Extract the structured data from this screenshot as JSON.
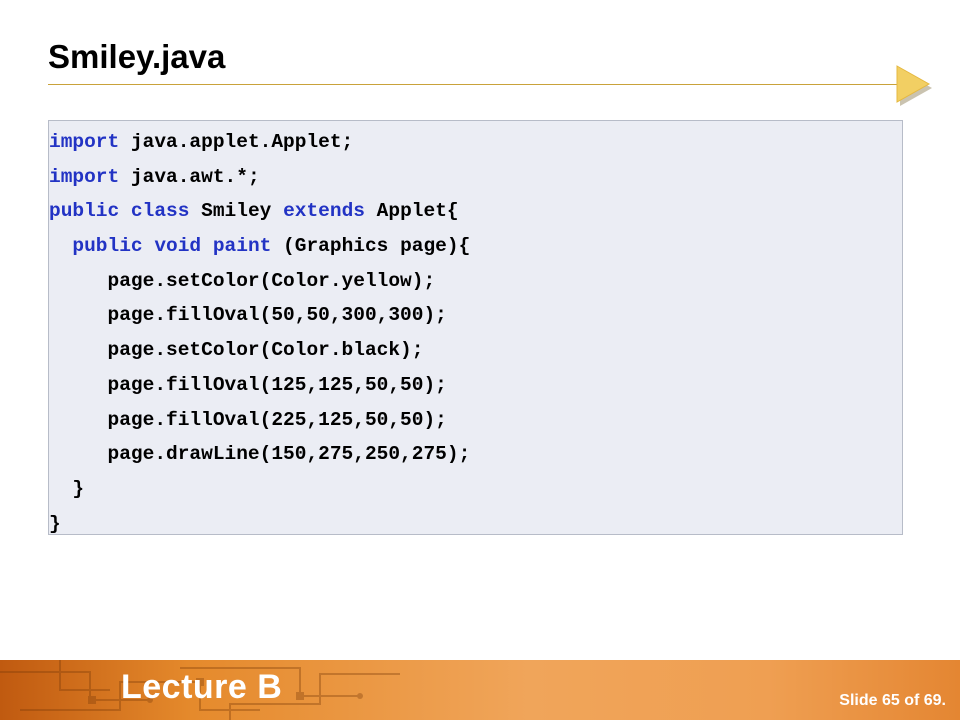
{
  "slide": {
    "title": "Smiley.java",
    "accent_color": "#c9a23a",
    "arrow_icon": "play-arrow-icon"
  },
  "code": {
    "keyword_color": "#2233c4",
    "lines": [
      [
        {
          "t": "import",
          "kw": true
        },
        {
          "t": " java.applet.Applet;",
          "kw": false
        }
      ],
      [
        {
          "t": "import",
          "kw": true
        },
        {
          "t": " java.awt.*;",
          "kw": false
        }
      ],
      [
        {
          "t": "public",
          "kw": true
        },
        {
          "t": " ",
          "kw": false
        },
        {
          "t": "class",
          "kw": true
        },
        {
          "t": " Smiley ",
          "kw": false
        },
        {
          "t": "extends",
          "kw": true
        },
        {
          "t": " Applet{",
          "kw": false
        }
      ],
      [
        {
          "t": "  ",
          "kw": false
        },
        {
          "t": "public",
          "kw": true
        },
        {
          "t": " ",
          "kw": false
        },
        {
          "t": "void",
          "kw": true
        },
        {
          "t": " ",
          "kw": false
        },
        {
          "t": "paint",
          "kw": true
        },
        {
          "t": " (Graphics page){",
          "kw": false
        }
      ],
      [
        {
          "t": "     page.setColor(Color.yellow);",
          "kw": false
        }
      ],
      [
        {
          "t": "     page.fillOval(50,50,300,300);",
          "kw": false
        }
      ],
      [
        {
          "t": "     page.setColor(Color.black);",
          "kw": false
        }
      ],
      [
        {
          "t": "     page.fillOval(125,125,50,50);",
          "kw": false
        }
      ],
      [
        {
          "t": "     page.fillOval(225,125,50,50);",
          "kw": false
        }
      ],
      [
        {
          "t": "     page.drawLine(150,275,250,275);",
          "kw": false
        }
      ],
      [
        {
          "t": "  }",
          "kw": false
        }
      ],
      [
        {
          "t": "}",
          "kw": false
        }
      ]
    ]
  },
  "footer": {
    "lecture": "Lecture B",
    "slide_number": "Slide 65 of 69."
  }
}
